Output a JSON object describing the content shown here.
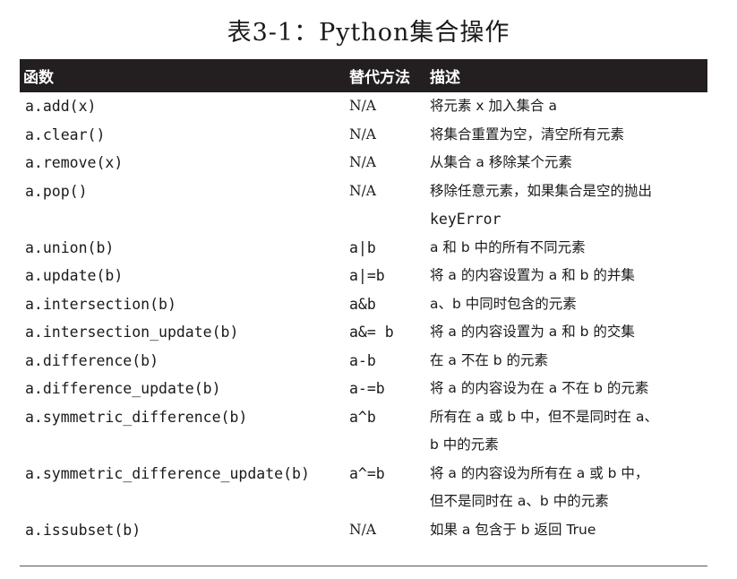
{
  "title": "表3-1：Python集合操作",
  "table": {
    "headers": [
      "函数",
      "替代方法",
      "描述"
    ],
    "rows": [
      {
        "func": "a.add(x)",
        "alt": "N/A",
        "alt_mono": false,
        "desc": [
          "将元素 x 加入集合 a"
        ]
      },
      {
        "func": "a.clear()",
        "alt": "N/A",
        "alt_mono": false,
        "desc": [
          "将集合重置为空，清空所有元素"
        ]
      },
      {
        "func": "a.remove(x)",
        "alt": "N/A",
        "alt_mono": false,
        "desc": [
          "从集合 a 移除某个元素"
        ]
      },
      {
        "func": "a.pop()",
        "alt": "N/A",
        "alt_mono": false,
        "desc": [
          "移除任意元素，如果集合是空的抛出",
          "keyError"
        ]
      },
      {
        "func": "a.union(b)",
        "alt": "a|b",
        "alt_mono": true,
        "desc": [
          "a 和 b 中的所有不同元素"
        ]
      },
      {
        "func": "a.update(b)",
        "alt": "a|=b",
        "alt_mono": true,
        "desc": [
          "将 a 的内容设置为 a 和 b 的并集"
        ]
      },
      {
        "func": "a.intersection(b)",
        "alt": "a&b",
        "alt_mono": true,
        "desc": [
          "a、b 中同时包含的元素"
        ]
      },
      {
        "func": "a.intersection_update(b)",
        "alt": "a&= b",
        "alt_mono": true,
        "desc": [
          "将 a 的内容设置为 a 和 b 的交集"
        ]
      },
      {
        "func": "a.difference(b)",
        "alt": "a-b",
        "alt_mono": true,
        "desc": [
          "在 a 不在 b 的元素"
        ]
      },
      {
        "func": "a.difference_update(b)",
        "alt": "a-=b",
        "alt_mono": true,
        "desc": [
          "将 a 的内容设为在 a 不在 b 的元素"
        ]
      },
      {
        "func": "a.symmetric_difference(b)",
        "alt": "a^b",
        "alt_mono": true,
        "desc": [
          "所有在 a 或 b 中，但不是同时在 a、",
          "b 中的元素"
        ]
      },
      {
        "func": "a.symmetric_difference_update(b)",
        "alt": "a^=b",
        "alt_mono": true,
        "desc": [
          "将 a 的内容设为所有在 a 或 b 中，",
          "但不是同时在 a、b 中的元素"
        ]
      },
      {
        "func": "a.issubset(b)",
        "alt": "N/A",
        "alt_mono": false,
        "desc": [
          "如果 a 包含于 b 返回 True"
        ]
      }
    ]
  }
}
